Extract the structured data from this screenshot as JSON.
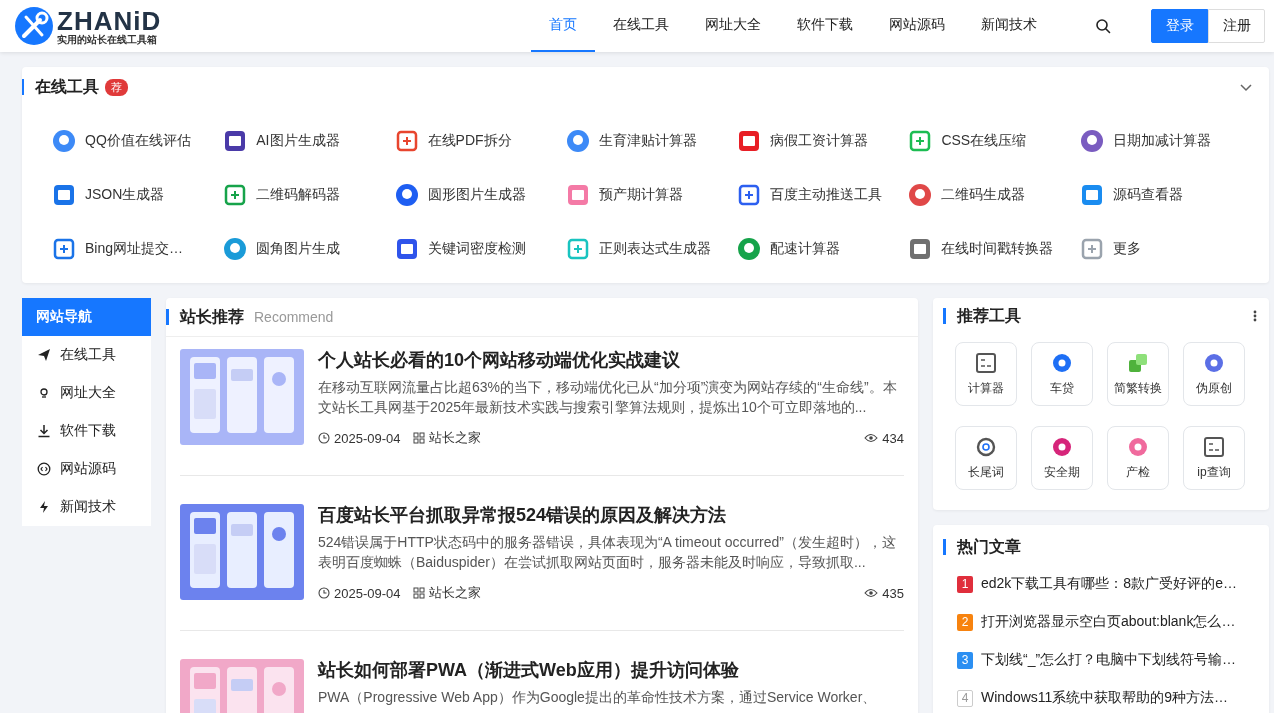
{
  "header": {
    "logo_text": "ZHANiD",
    "logo_subtitle": "实用的站长在线工具箱",
    "nav": [
      {
        "label": "首页",
        "selected": true
      },
      {
        "label": "在线工具",
        "selected": false
      },
      {
        "label": "网址大全",
        "selected": false
      },
      {
        "label": "软件下载",
        "selected": false
      },
      {
        "label": "网站源码",
        "selected": false
      },
      {
        "label": "新闻技术",
        "selected": false
      }
    ],
    "login": "登录",
    "register": "注册"
  },
  "tools_panel": {
    "title": "在线工具",
    "badge": "荐",
    "expanded": true,
    "tools": [
      "QQ价值在线评估",
      "AI图片生成器",
      "在线PDF拆分",
      "生育津贴计算器",
      "病假工资计算器",
      "CSS在线压缩",
      "日期加减计算器",
      "JSON生成器",
      "二维码解码器",
      "圆形图片生成器",
      "预产期计算器",
      "百度主动推送工具",
      "二维码生成器",
      "源码查看器",
      "Bing网址提交…",
      "圆角图片生成",
      "关键词密度检测",
      "正则表达式生成器",
      "配速计算器",
      "在线时间戳转换器",
      "更多"
    ]
  },
  "site_nav": {
    "title": "网站导航",
    "items": [
      "在线工具",
      "网址大全",
      "软件下载",
      "网站源码",
      "新闻技术"
    ]
  },
  "recommend": {
    "title": "站长推荐",
    "subtitle": "Recommend",
    "articles": [
      {
        "kind": "picture",
        "title": "个人站长必看的10个网站移动端优化实战建议",
        "excerpt": "在移动互联网流量占比超63%的当下，移动端优化已从“加分项”演变为网站存续的“生命线”。本文站长工具网基于2025年最新技术实践与搜索引擎算法规则，提炼出10个可立即落地的...",
        "date": "2025-09-04",
        "source": "站长之家",
        "views": "434"
      },
      {
        "kind": "picture",
        "title": "百度站长平台抓取异常报524错误的原因及解决方法",
        "excerpt": "524错误属于HTTP状态码中的服务器错误，具体表现为“A timeout occurred”（发生超时），这表明百度蜘蛛（Baiduspider）在尝试抓取网站页面时，服务器未能及时响应，导致抓取...",
        "date": "2025-09-04",
        "source": "站长之家",
        "views": "435"
      },
      {
        "kind": "picture",
        "title": "站长如何部署PWA（渐进式Web应用）提升访问体验",
        "excerpt": "PWA（Progressive Web App）作为Google提出的革命性技术方案，通过Service Worker、"
      }
    ]
  },
  "recommended_tools": {
    "title": "推荐工具",
    "items": [
      "计算器",
      "车贷",
      "简繁转换",
      "伪原创",
      "长尾词",
      "安全期",
      "产检",
      "ip查询"
    ]
  },
  "hot_articles": {
    "title": "热门文章",
    "items": [
      {
        "rank": "1",
        "kind": "top",
        "color": "#e02f3c",
        "title": "ed2k下载工具有哪些：8款广受好评的e…"
      },
      {
        "rank": "2",
        "kind": "top",
        "color": "#f7830f",
        "title": "打开浏览器显示空白页about:blank怎么…"
      },
      {
        "rank": "3",
        "kind": "top",
        "color": "#2b8ff2",
        "title": "下划线“_”怎么打？电脑中下划线符号输…"
      },
      {
        "rank": "4",
        "kind": "normal",
        "color": "#999999",
        "title": "Windows11系统中获取帮助的9种方法…"
      }
    ]
  }
}
